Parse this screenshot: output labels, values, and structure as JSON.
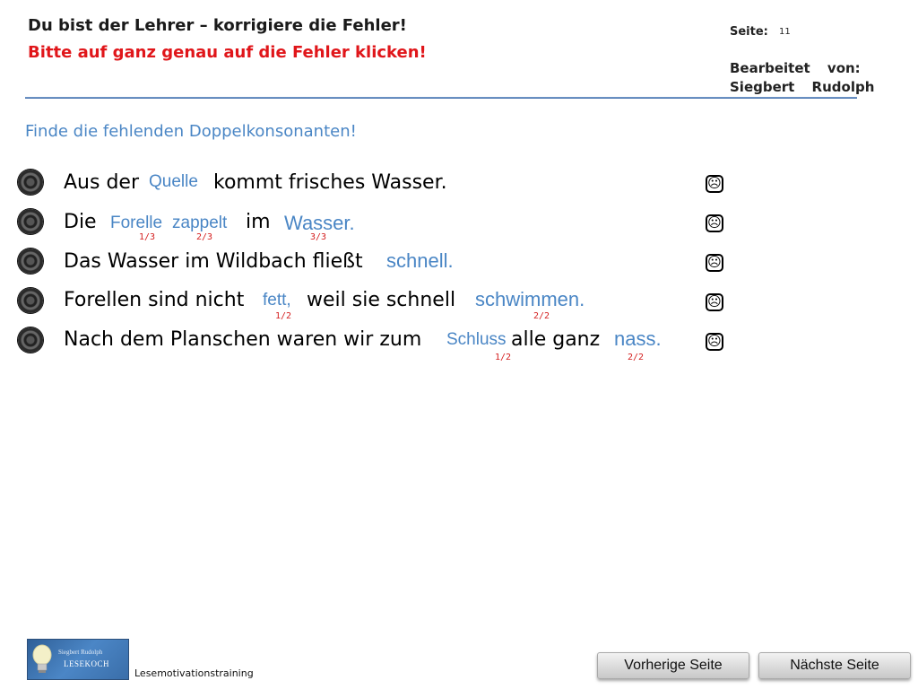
{
  "header": {
    "title": "Du bist der Lehrer – korrigiere die Fehler!",
    "subtitle": "Bitte auf ganz genau auf die Fehler klicken!",
    "page_label": "Seite:",
    "page_number": "11",
    "edited_by": "Bearbeitet von:",
    "author": "Siegbert Rudolph"
  },
  "task": "Finde die fehlenden Doppelkonsonanten!",
  "sentences": [
    {
      "parts": [
        "Aus der",
        "kommt frisches Wasser."
      ],
      "fixes": [
        "Quelle"
      ],
      "scores": []
    },
    {
      "parts": [
        "Die",
        "im"
      ],
      "fixes": [
        "Forelle",
        "zappelt",
        "Wasser."
      ],
      "scores": [
        "1/3",
        "2/3",
        "3/3"
      ]
    },
    {
      "parts": [
        "Das Wasser im Wildbach fließt"
      ],
      "fixes": [
        "schnell."
      ],
      "scores": []
    },
    {
      "parts": [
        "Forellen sind nicht",
        "weil sie schnell"
      ],
      "fixes": [
        "fett,",
        "schwimmen."
      ],
      "scores": [
        "1/2",
        "2/2"
      ]
    },
    {
      "parts": [
        "Nach dem Planschen waren wir zum",
        "alle ganz"
      ],
      "fixes": [
        "Schluss",
        "nass."
      ],
      "scores": [
        "1/2",
        "2/2"
      ]
    }
  ],
  "feedback_icon": "frown-face-icon",
  "footer": {
    "logo_line1": "Siegbert Rudolph",
    "logo_line2": "LESEKOCH",
    "label": "Lesemotivationstraining"
  },
  "nav": {
    "prev": "Vorherige Seite",
    "next": "Nächste Seite"
  },
  "colors": {
    "title": "#1a1a1a",
    "subtitle": "#e0161a",
    "accent": "#4a86c5",
    "score": "#d42020"
  }
}
